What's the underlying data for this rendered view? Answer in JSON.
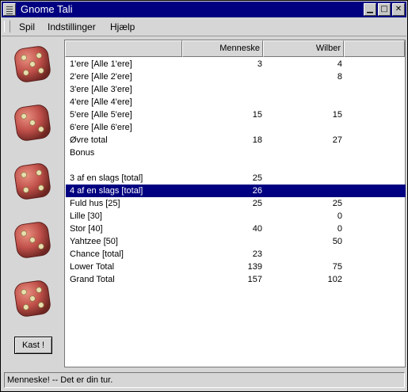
{
  "window": {
    "title": "Gnome Tali"
  },
  "menu": [
    "Spil",
    "Indstillinger",
    "Hjælp"
  ],
  "dice": [
    5,
    3,
    4,
    3,
    5
  ],
  "roll_button": "Kast !",
  "columns": [
    "",
    "Menneske",
    "Wilber"
  ],
  "rows": [
    [
      "1'ere [Alle 1'ere]",
      "3",
      "4"
    ],
    [
      "2'ere [Alle 2'ere]",
      "",
      "8"
    ],
    [
      "3'ere [Alle 3'ere]",
      "",
      ""
    ],
    [
      "4'ere [Alle 4'ere]",
      "",
      ""
    ],
    [
      "5'ere [Alle 5'ere]",
      "15",
      "15"
    ],
    [
      "6'ere [Alle 6'ere]",
      "",
      ""
    ],
    [
      "Øvre total",
      "18",
      "27"
    ],
    [
      "Bonus",
      "",
      ""
    ],
    [
      "",
      "",
      ""
    ],
    [
      "3 af en slags [total]",
      "25",
      ""
    ],
    [
      "4 af en slags [total]",
      "26",
      ""
    ],
    [
      "Fuld hus [25]",
      "25",
      "25"
    ],
    [
      "Lille [30]",
      "",
      "0"
    ],
    [
      "Stor [40]",
      "40",
      "0"
    ],
    [
      "Yahtzee [50]",
      "",
      "50"
    ],
    [
      "Chance [total]",
      "23",
      ""
    ],
    [
      "Lower Total",
      "139",
      "75"
    ],
    [
      "Grand Total",
      "157",
      "102"
    ]
  ],
  "selected_row": 10,
  "status": "Menneske! -- Det er din tur.",
  "colors": {
    "titlebar": "#000080",
    "selection": "#000080",
    "die": "#c0504a"
  }
}
